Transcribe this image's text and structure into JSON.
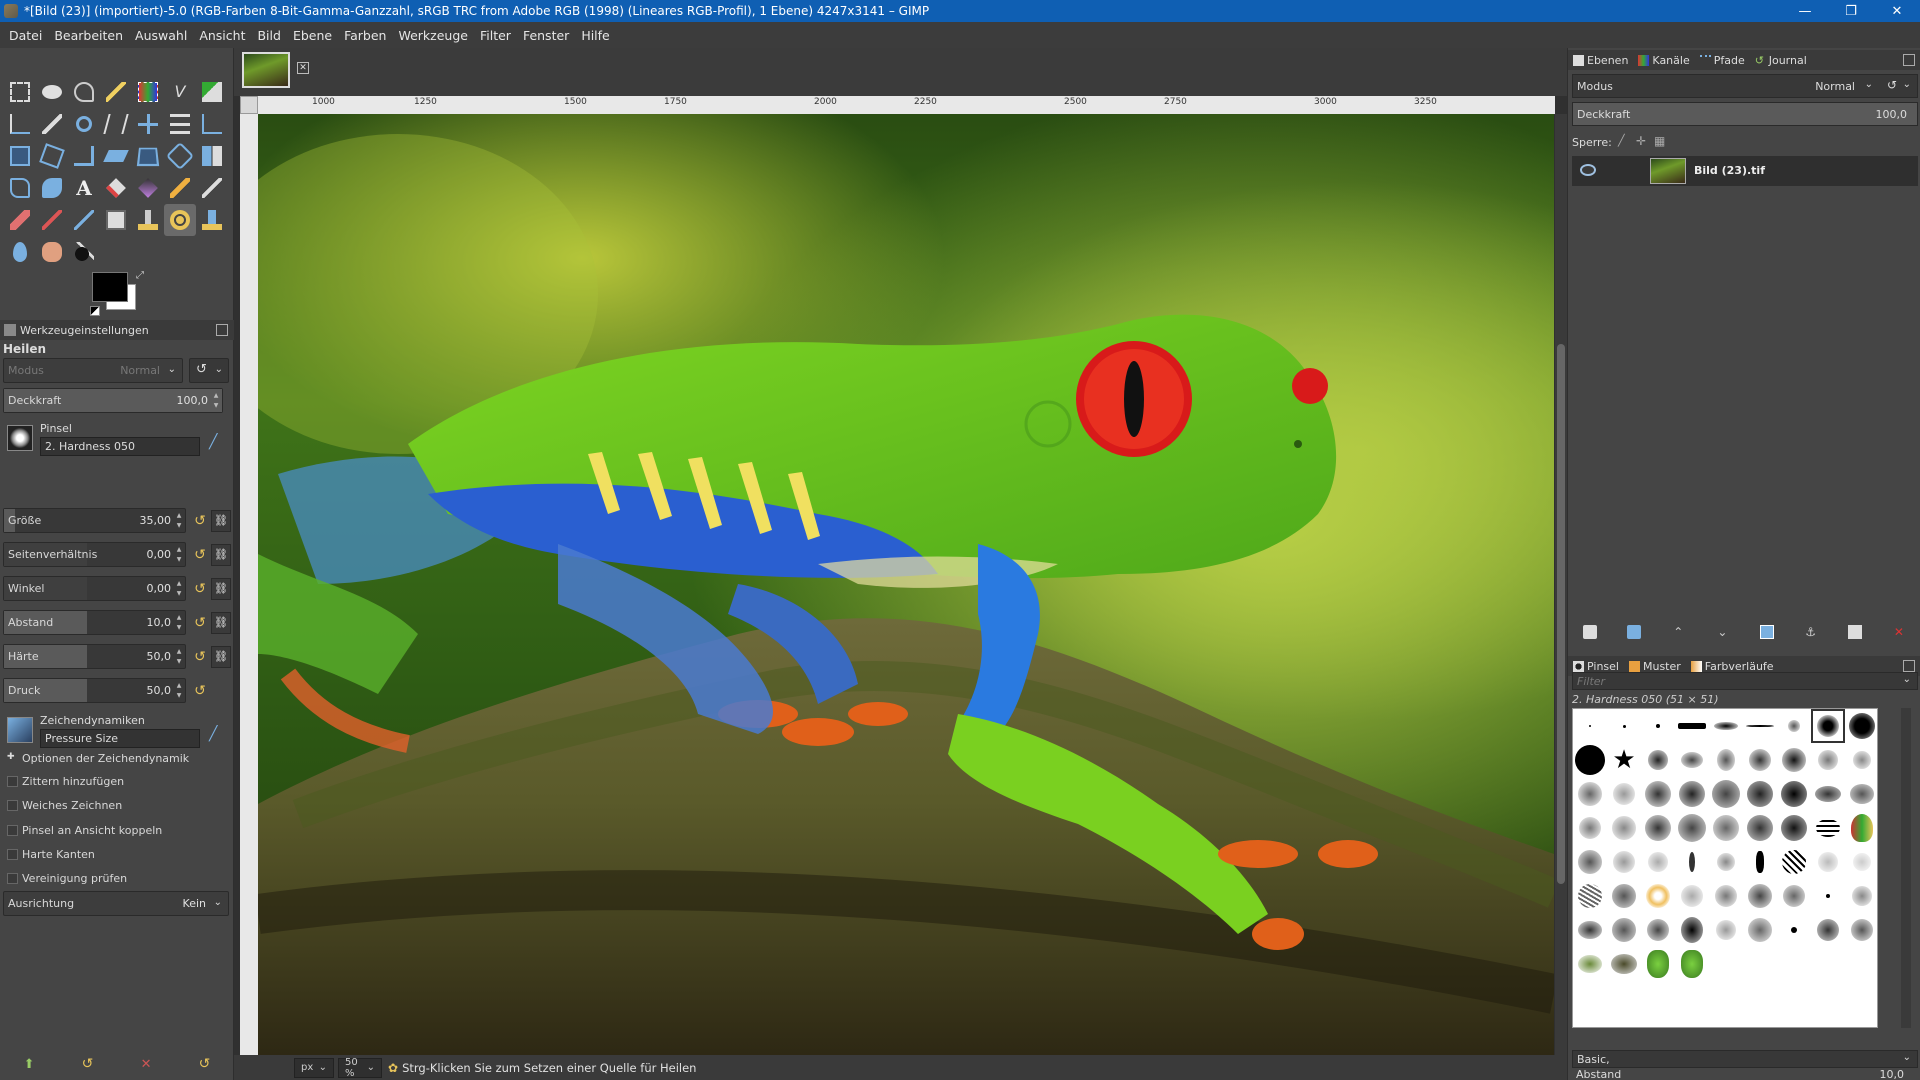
{
  "window": {
    "title": "*[Bild (23)] (importiert)-5.0 (RGB-Farben 8-Bit-Gamma-Ganzzahl, sRGB TRC from Adobe RGB (1998) (Lineares RGB-Profil), 1 Ebene) 4247x3141 – GIMP",
    "minimize": "—",
    "maximize": "❐",
    "close": "✕"
  },
  "menu": [
    "Datei",
    "Bearbeiten",
    "Auswahl",
    "Ansicht",
    "Bild",
    "Ebene",
    "Farben",
    "Werkzeuge",
    "Filter",
    "Fenster",
    "Hilfe"
  ],
  "tool_options": {
    "tab_label": "Werkzeugeinstellungen",
    "tool_name": "Heilen",
    "mode_label": "Modus",
    "mode_value": "Normal",
    "opacity_label": "Deckkraft",
    "opacity_value": "100,0",
    "brush_label": "Pinsel",
    "brush_value": "2. Hardness 050",
    "size_label": "Größe",
    "size_value": "35,00",
    "aspect_label": "Seitenverhältnis",
    "aspect_value": "0,00",
    "angle_label": "Winkel",
    "angle_value": "0,00",
    "spacing_label": "Abstand",
    "spacing_value": "10,0",
    "hardness_label": "Härte",
    "hardness_value": "50,0",
    "force_label": "Druck",
    "force_value": "50,0",
    "dynamics_label": "Zeichendynamiken",
    "dynamics_value": "Pressure Size",
    "dynamics_options": "Optionen der Zeichendynamik",
    "jitter": "Zittern hinzufügen",
    "smooth": "Weiches Zeichnen",
    "lock_brush": "Pinsel an Ansicht koppeln",
    "hard_edges": "Harte Kanten",
    "sample_merged": "Vereinigung prüfen",
    "alignment_label": "Ausrichtung",
    "alignment_value": "Kein"
  },
  "ruler": {
    "labels": [
      "1000",
      "1250",
      "1500",
      "1750",
      "2000",
      "2250",
      "2500",
      "2750",
      "3000",
      "3250"
    ]
  },
  "status": {
    "unit": "px",
    "zoom": "50 %",
    "message": "Strg-Klicken Sie zum Setzen einer Quelle für Heilen"
  },
  "layers_dock": {
    "tabs": [
      "Ebenen",
      "Kanäle",
      "Pfade",
      "Journal"
    ],
    "mode_label": "Modus",
    "mode_value": "Normal",
    "opacity_label": "Deckkraft",
    "opacity_value": "100,0",
    "lock_label": "Sperre:",
    "layer_name": "Bild (23).tif"
  },
  "brushes_dock": {
    "tabs": [
      "Pinsel",
      "Muster",
      "Farbverläufe"
    ],
    "filter_placeholder": "Filter",
    "selected_brush": "2. Hardness 050 (51 × 51)",
    "tag_value": "Basic,",
    "spacing_label": "Abstand",
    "spacing_value": "10,0"
  },
  "colors": {
    "titlebar": "#0f5fb3",
    "panel": "#454545",
    "accent": "#e8c45a"
  }
}
